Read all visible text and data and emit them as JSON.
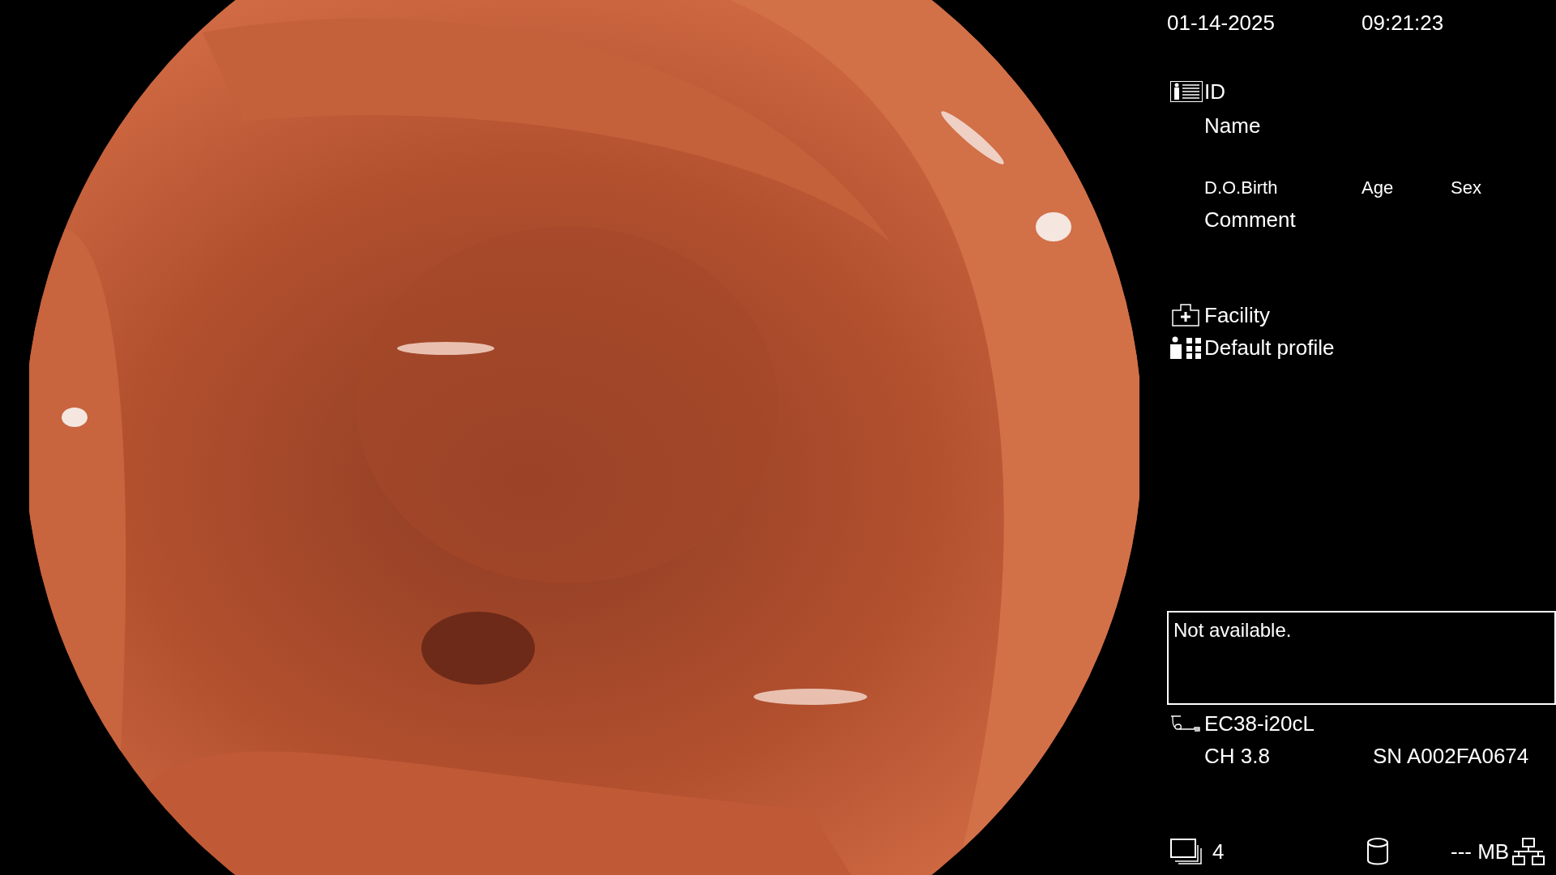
{
  "header": {
    "date": "01-14-2025",
    "time": "09:21:23"
  },
  "patient": {
    "id_label": "ID",
    "name_label": "Name",
    "birth_label": "D.O.Birth",
    "age_label": "Age",
    "sex_label": "Sex",
    "comment_label": "Comment"
  },
  "facility": {
    "label": "Facility"
  },
  "profile": {
    "label": "Default profile"
  },
  "message_box": {
    "text": "Not available."
  },
  "scope": {
    "model": "EC38-i20cL",
    "channel": "CH 3.8",
    "serial": "SN A002FA0674"
  },
  "status_bar": {
    "image_count": "4",
    "storage": "--- MB"
  }
}
